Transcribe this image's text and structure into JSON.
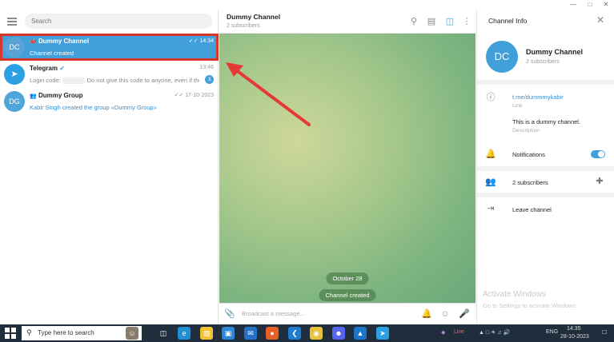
{
  "search": {
    "placeholder": "Search"
  },
  "chats": [
    {
      "initials": "DC",
      "avatar_color": "#5aa3d6",
      "title": "Dummy Channel",
      "time": "14:34",
      "subtitle": "Channel created",
      "active": true
    },
    {
      "initials": "",
      "avatar_color": "#2d9fe3",
      "title": "Telegram",
      "time": "13:46",
      "subtitle": "Login code: ░░░░░. Do not give this code to anyone, even if they...",
      "badge": "3"
    },
    {
      "initials": "DG",
      "avatar_color": "#4fa6d8",
      "title": "Dummy Group",
      "time": "17-10-2023",
      "subtitle": "Kabir Singh created the group «Dummy Group»"
    }
  ],
  "header": {
    "title": "Dummy Channel",
    "subtitle": "2 subscribers"
  },
  "messages": {
    "date_pill": "October 28",
    "service_pill": "Channel created"
  },
  "composer": {
    "placeholder": "Broadcast a message..."
  },
  "info": {
    "heading": "Channel Info",
    "initials": "DC",
    "name": "Dummy Channel",
    "subscribers": "2 subscribers",
    "link": "t.me/dummmykabir",
    "link_label": "Link",
    "description": "This is a dummy channel.",
    "description_label": "Description",
    "notifications_label": "Notifications",
    "subscribers_row": "2 subscribers",
    "leave_label": "Leave channel"
  },
  "watermark": {
    "line1": "Activate Windows",
    "line2": "Go to Settings to activate Windows."
  },
  "taskbar": {
    "search_placeholder": "Type here to search",
    "live_label": "Live",
    "language": "ENG",
    "time": "14:35",
    "date": "28-10-2023"
  },
  "colors": {
    "accent": "#419fd9",
    "highlight": "#d9362b",
    "taskbar": "#1f2d3c"
  }
}
